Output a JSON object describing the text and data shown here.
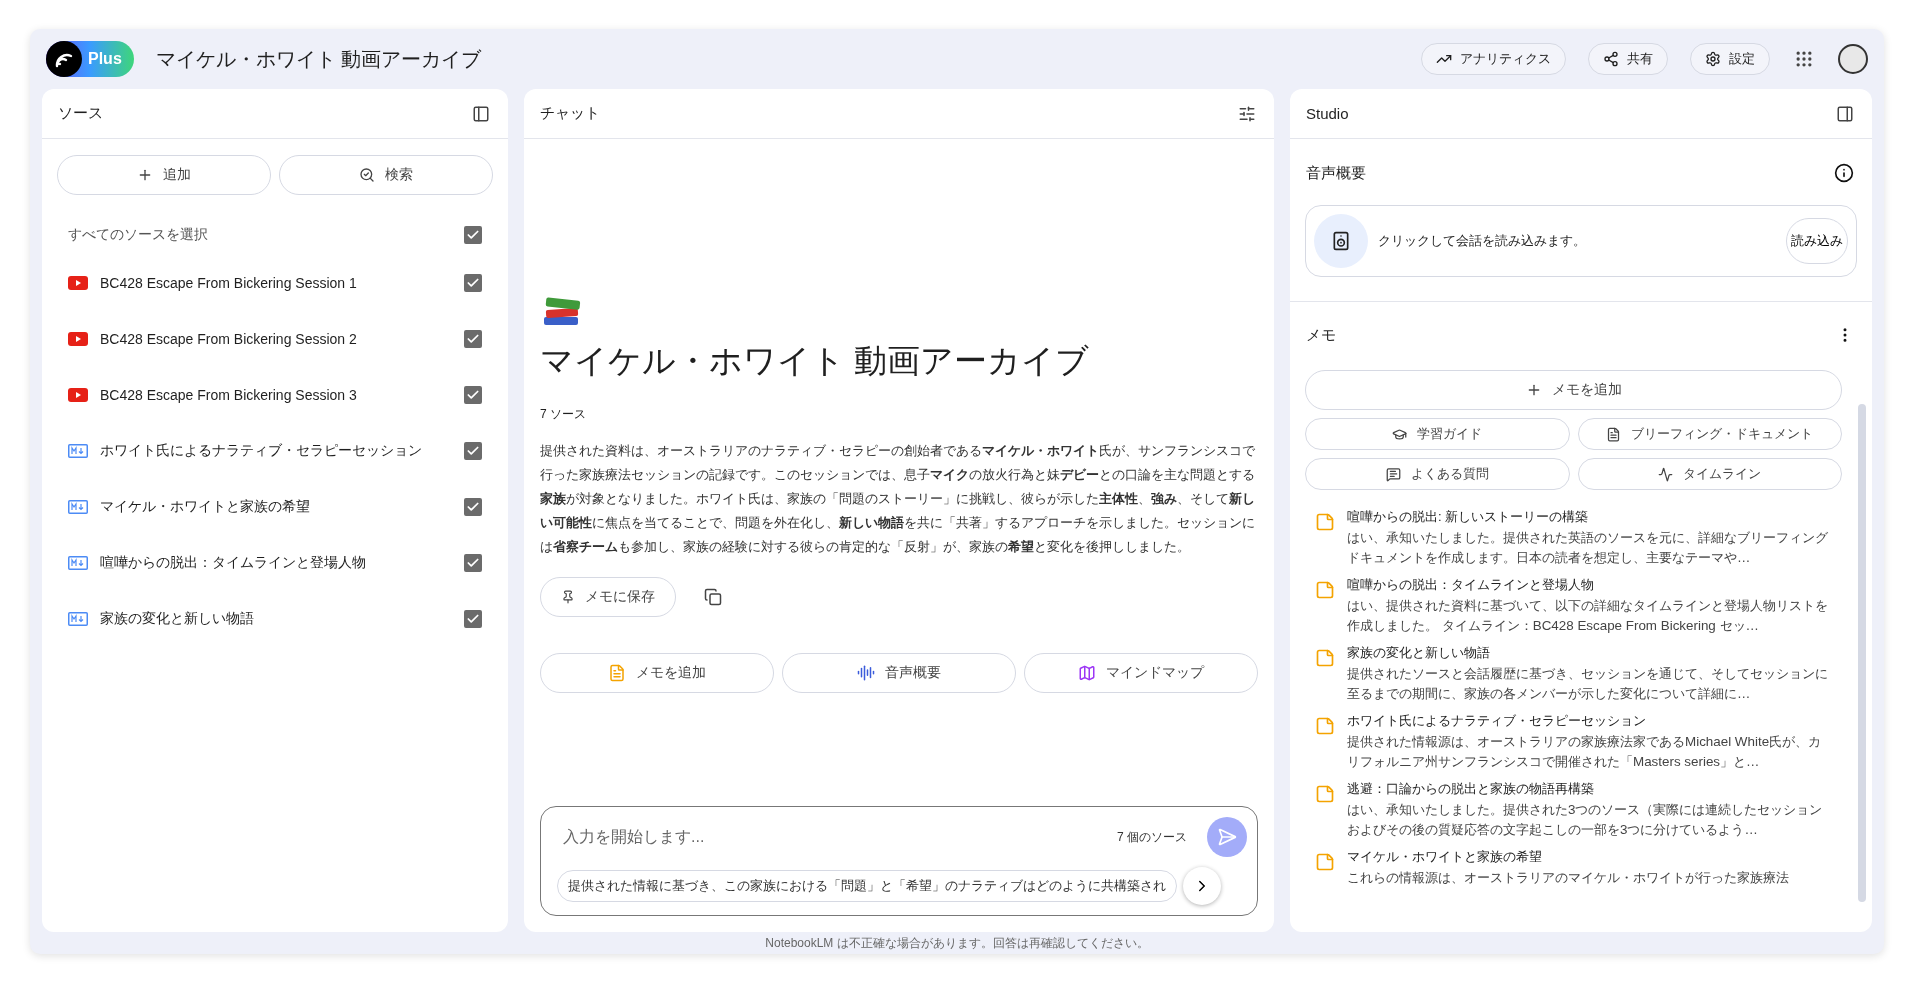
{
  "header": {
    "badge": "Plus",
    "title": "マイケル・ホワイト 動画アーカイブ",
    "actions": [
      {
        "kind": "analytics",
        "label": "アナリティクス"
      },
      {
        "kind": "share",
        "label": "共有"
      },
      {
        "kind": "settings",
        "label": "設定"
      }
    ]
  },
  "sources": {
    "title": "ソース",
    "add": "追加",
    "search": "検索",
    "select_all": {
      "label": "すべてのソースを選択",
      "checked": true
    },
    "items": [
      {
        "kind": "youtube",
        "label": "BC428 Escape From Bickering Session 1",
        "checked": true
      },
      {
        "kind": "youtube",
        "label": "BC428 Escape From Bickering Session 2",
        "checked": true
      },
      {
        "kind": "youtube",
        "label": "BC428 Escape From Bickering Session 3",
        "checked": true
      },
      {
        "kind": "markdown",
        "label": "ホワイト氏によるナラティブ・セラピーセッション",
        "checked": true
      },
      {
        "kind": "markdown",
        "label": "マイケル・ホワイトと家族の希望",
        "checked": true
      },
      {
        "kind": "markdown",
        "label": "喧嘩からの脱出：タイムラインと登場人物",
        "checked": true
      },
      {
        "kind": "markdown",
        "label": "家族の変化と新しい物語",
        "checked": true
      }
    ]
  },
  "chat": {
    "title": "チャット",
    "notebook_title": "マイケル・ホワイト 動画アーカイブ",
    "source_count": "7 ソース",
    "summary": "提供された資料は、オーストラリアのナラティブ・セラピーの創始者である**マイケル・ホワイト**氏が、サンフランシスコで行った家族療法セッションの記録です。このセッションでは、息子**マイク**の放火行為と妹**デビー**との口論を主な問題とする**家族**が対象となりました。ホワイト氏は、家族の「問題のストーリー」に挑戦し、彼らが示した**主体性**、**強み**、そして**新しい可能性**に焦点を当てることで、問題を外在化し、**新しい物語**を共に「共著」するアプローチを示しました。セッションには**省察チーム**も参加し、家族の経験に対する彼らの肯定的な「反射」が、家族の**希望**と変化を後押ししました。",
    "save_note": "メモに保存",
    "actions": [
      {
        "kind": "note",
        "label": "メモを追加"
      },
      {
        "kind": "audio",
        "label": "音声概要"
      },
      {
        "kind": "mindmap",
        "label": "マインドマップ"
      }
    ],
    "input": {
      "placeholder": "入力を開始します...",
      "source_count": "7 個のソース"
    },
    "suggestion": "提供された情報に基づき、この家族における「問題」と「希望」のナラティブはどのように共構築され"
  },
  "studio": {
    "title": "Studio",
    "audio_heading": "音声概要",
    "audio_prompt": "クリックして会話を読み込みます。",
    "load": "読み込み",
    "memo_heading": "メモ",
    "add_memo": "メモを追加",
    "tools": [
      {
        "kind": "guide",
        "label": "学習ガイド"
      },
      {
        "kind": "briefing",
        "label": "ブリーフィング・ドキュメント"
      },
      {
        "kind": "faq",
        "label": "よくある質問"
      },
      {
        "kind": "timeline",
        "label": "タイムライン"
      }
    ],
    "notes": [
      {
        "title": "喧嘩からの脱出: 新しいストーリーの構築",
        "preview": "はい、承知いたしました。提供された英語のソースを元に、詳細なブリーフィングドキュメントを作成します。日本の読者を想定し、主要なテーマや…"
      },
      {
        "title": "喧嘩からの脱出：タイムラインと登場人物",
        "preview": "はい、提供された資料に基づいて、以下の詳細なタイムラインと登場人物リストを作成しました。 タイムライン：BC428 Escape From Bickering セッ…"
      },
      {
        "title": "家族の変化と新しい物語",
        "preview": "提供されたソースと会話履歴に基づき、セッションを通じて、そしてセッションに至るまでの期間に、家族の各メンバーが示した変化について詳細に…"
      },
      {
        "title": "ホワイト氏によるナラティブ・セラピーセッション",
        "preview": "提供された情報源は、オーストラリアの家族療法家であるMichael White氏が、カリフォルニア州サンフランシスコで開催された「Masters series」と…"
      },
      {
        "title": "逃避：口論からの脱出と家族の物語再構築",
        "preview": "はい、承知いたしました。提供された3つのソース（実際には連続したセッションおよびその後の質疑応答の文字起こしの一部を3つに分けているよう…"
      },
      {
        "title": "マイケル・ホワイトと家族の希望",
        "preview": "これらの情報源は、オーストラリアのマイケル・ホワイトが行った家族療法"
      }
    ]
  },
  "footer": "NotebookLM は不正確な場合があります。回答は再確認してください。"
}
